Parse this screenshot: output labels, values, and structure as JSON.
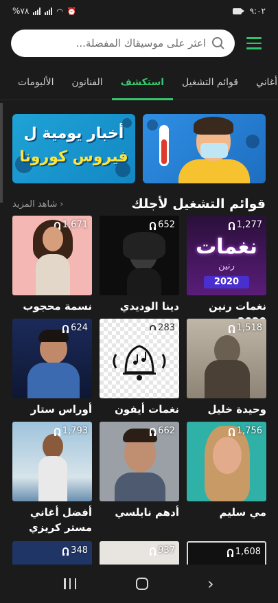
{
  "status": {
    "time": "٩:٠٢",
    "battery": "%٧٨"
  },
  "search": {
    "placeholder": "اعثر على موسيقاك المفضلة..."
  },
  "tabs": [
    {
      "label": "أغاني"
    },
    {
      "label": "قوائم التشغيل"
    },
    {
      "label": "استكشف"
    },
    {
      "label": "الفنانون"
    },
    {
      "label": "الألبومات"
    }
  ],
  "banners": {
    "covid_line1": "أخبار يومية ل",
    "covid_line2": "فيروس كورونا"
  },
  "section": {
    "title": "قوائم التشغيل لأجلك",
    "see_more": "شاهد المزيد"
  },
  "playlists": [
    {
      "title": "نغمات رنين 2020",
      "count": "1,277",
      "art_text_1": "نغمات",
      "art_text_2": "رنين",
      "art_text_3": "2020"
    },
    {
      "title": "دينا الوديدي",
      "count": "652"
    },
    {
      "title": "نسمة محجوب",
      "count": "1,671"
    },
    {
      "title": "وحيدة خليل",
      "count": "1,518"
    },
    {
      "title": "نغمات أيفون",
      "count": "283"
    },
    {
      "title": "أوراس ستار",
      "count": "624"
    },
    {
      "title": "مي سليم",
      "count": "1,756"
    },
    {
      "title": "أدهم نابلسي",
      "count": "662"
    },
    {
      "title": "أفضل أغاني مستر كريزي",
      "count": "1,793"
    },
    {
      "title": "",
      "count": "1,608"
    },
    {
      "title": "",
      "count": "937"
    },
    {
      "title": "",
      "count": "348"
    }
  ]
}
